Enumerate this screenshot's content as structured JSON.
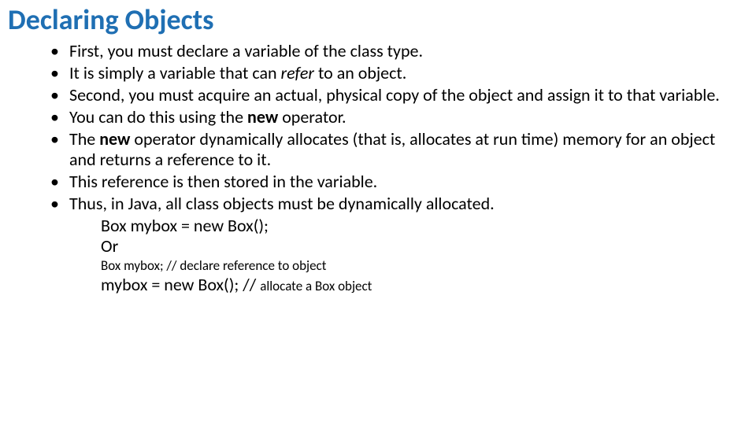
{
  "title": "Declaring Objects",
  "bullets": {
    "b1": "First, you must declare a variable of the class type.",
    "b2_a": "It is simply a variable that can ",
    "b2_refer": "refer",
    "b2_b": " to an object.",
    "b3": "Second, you must acquire an actual, physical copy of the object and assign it to that variable.",
    "b4_a": "You can do this using the ",
    "b4_new": "new ",
    "b4_b": "operator.",
    "b5_a": "The ",
    "b5_new": "new ",
    "b5_b": "operator dynamically allocates (that is, allocates at run time) memory for an object and returns a reference to it.",
    "b6": "This reference is then stored in the variable.",
    "b7": "Thus, in Java, all class objects must be dynamically allocated."
  },
  "code": {
    "line1": "Box mybox = new Box();",
    "line2": "Or",
    "line3": "Box mybox; // declare reference to object",
    "line4_a": "mybox = new Box(); // ",
    "line4_b": "allocate a Box object"
  }
}
